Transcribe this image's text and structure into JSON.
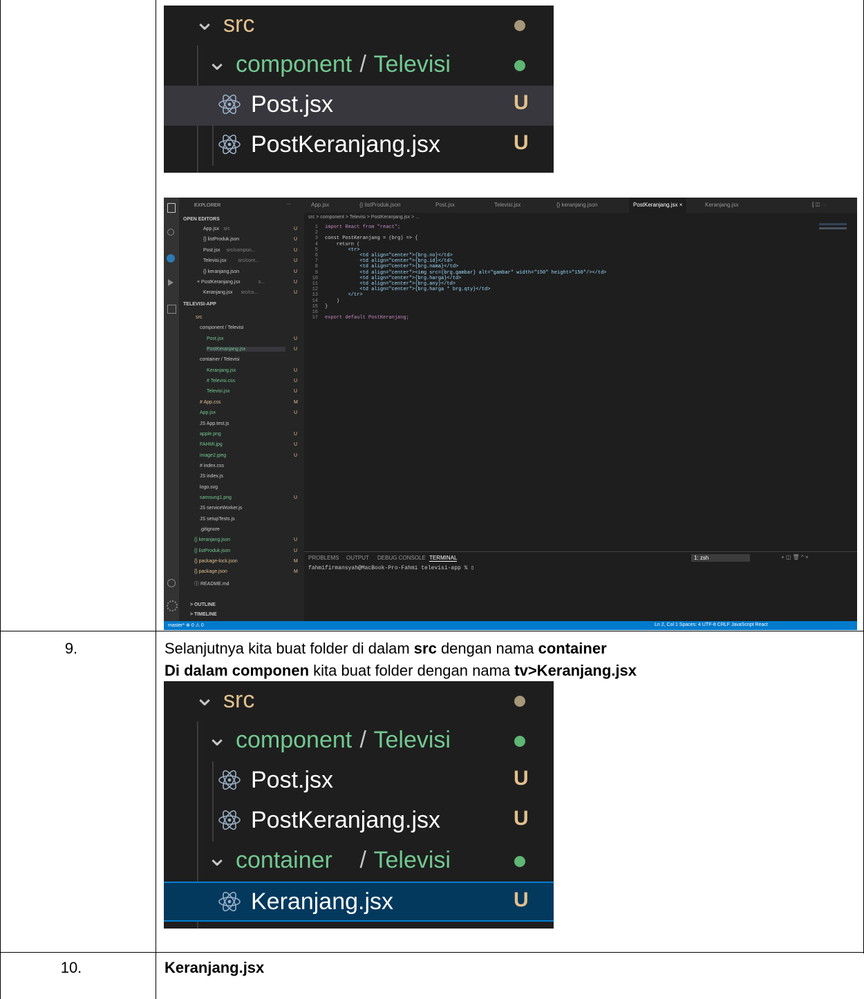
{
  "row8": {
    "crop1": {
      "items": [
        {
          "label": "src",
          "kind": "folder"
        },
        {
          "label": "component",
          "sep": "/",
          "label2": "Televisi",
          "kind": "folder"
        },
        {
          "label": "Post.jsx",
          "badge": "U",
          "kind": "file"
        },
        {
          "label": "PostKeranjang.jsx",
          "badge": "U",
          "kind": "file"
        }
      ]
    },
    "vscode": {
      "sidebar_title": "EXPLORER",
      "sidebar_dots": "···",
      "open_editors_label": "OPEN EDITORS",
      "open_editors": [
        {
          "label": "App.jsx",
          "desc": "src",
          "badge": "U"
        },
        {
          "label": "{} listProduk.json",
          "badge": "U"
        },
        {
          "label": "Post.jsx",
          "desc": "src/compon...",
          "badge": "U"
        },
        {
          "label": "Televisi.jsx",
          "desc": "src/cont...",
          "badge": "U"
        },
        {
          "label": "{} keranjang.json",
          "badge": "U"
        },
        {
          "label": "× PostKeranjang.jsx",
          "desc": "s...",
          "badge": "U"
        },
        {
          "label": "Keranjang.jsx",
          "desc": "src/co...",
          "badge": "U"
        }
      ],
      "project_label": "TELEVISI-APP",
      "tree": [
        {
          "label": "src",
          "badge": ""
        },
        {
          "label": "component / Televisi",
          "badge": ""
        },
        {
          "label": "Post.jsx",
          "badge": "U"
        },
        {
          "label": "PostKeranjang.jsx",
          "badge": "U"
        },
        {
          "label": "container / Televisi",
          "badge": ""
        },
        {
          "label": "Keranjang.jsx",
          "badge": "U"
        },
        {
          "label": "# Televisi.css",
          "badge": "U"
        },
        {
          "label": "Televisi.jsx",
          "badge": "U"
        },
        {
          "label": "# App.css",
          "badge": "M"
        },
        {
          "label": "App.jsx",
          "badge": "U"
        },
        {
          "label": "JS App.test.js",
          "badge": ""
        },
        {
          "label": "apple.png",
          "badge": "U"
        },
        {
          "label": "FAHMI.jpg",
          "badge": "U"
        },
        {
          "label": "image2.jpeg",
          "badge": "U"
        },
        {
          "label": "# index.css",
          "badge": ""
        },
        {
          "label": "JS index.js",
          "badge": ""
        },
        {
          "label": "logo.svg",
          "badge": ""
        },
        {
          "label": "samsung1.png",
          "badge": "U"
        },
        {
          "label": "JS serviceWorker.js",
          "badge": ""
        },
        {
          "label": "JS setupTests.js",
          "badge": ""
        },
        {
          "label": ".gitignore",
          "badge": ""
        },
        {
          "label": "{} keranjang.json",
          "badge": "U"
        },
        {
          "label": "{} listProduk.json",
          "badge": "U"
        },
        {
          "label": "{} package-lock.json",
          "badge": "M"
        },
        {
          "label": "{} package.json",
          "badge": "M"
        },
        {
          "label": "ⓘ README.md",
          "badge": ""
        }
      ],
      "outline_label": "> OUTLINE",
      "timeline_label": "> TIMELINE",
      "tabs": [
        "App.jsx",
        "{} listProduk.json",
        "Post.jsx",
        "Televisi.jsx",
        "{} keranjang.json",
        "PostKeranjang.jsx ×",
        "Keranjang.jsx"
      ],
      "breadcrumb": "src > component > Televisi > PostKeranjang.jsx > ...",
      "code_lines": [
        "import React from \"react\";",
        "",
        "const PostKeranjang = (brg) => {",
        "    return (",
        "        <tr>",
        "            <td align=\"center\">{brg.no}</td>",
        "            <td align=\"center\">{brg.id}</td>",
        "            <td align=\"center\">{brg.nama}</td>",
        "            <td align=\"center\"><img src={brg.gambar} alt=\"gambar\" width=\"150\" height=\"150\"/></td>",
        "            <td align=\"center\">{brg.harga}</td>",
        "            <td align=\"center\">{brg.any}</td>",
        "            <td align=\"center\">{brg.harga * brg.qty}</td>",
        "        </tr>",
        "    )",
        "}",
        "",
        "export default PostKeranjang;"
      ],
      "panel_tabs": [
        "PROBLEMS",
        "OUTPUT",
        "DEBUG CONSOLE",
        "TERMINAL"
      ],
      "terminal_select": "1: zsh",
      "terminal_line": "fahmifirmansyah@MacBook-Pro-Fahmi televisi-app % ▯",
      "status_left": "master*   ⊗ 0 ⚠ 0",
      "status_right": "Ln 2, Col 1   Spaces: 4   UTF-8   CRLF   JavaScript React"
    }
  },
  "row9": {
    "number": "9.",
    "line1_parts": [
      {
        "text": "Selanjutnya kita buat folder di dalam ",
        "bold": false
      },
      {
        "text": "src",
        "bold": true
      },
      {
        "text": " dengan nama ",
        "bold": false
      },
      {
        "text": "container",
        "bold": true
      }
    ],
    "line2_parts": [
      {
        "text": "Di dalam componen",
        "bold": true
      },
      {
        "text": " kita buat folder dengan nama ",
        "bold": false
      },
      {
        "text": "tv>Keranjang.jsx",
        "bold": true
      }
    ],
    "crop2": {
      "items": [
        {
          "label": "src",
          "kind": "folder"
        },
        {
          "label": "component",
          "sep": "/",
          "label2": "Televisi",
          "kind": "folder"
        },
        {
          "label": "Post.jsx",
          "badge": "U",
          "kind": "file"
        },
        {
          "label": "PostKeranjang.jsx",
          "badge": "U",
          "kind": "file"
        },
        {
          "label": "container",
          "sep": "/",
          "label2": "Televisi",
          "kind": "folder"
        },
        {
          "label": "Keranjang.jsx",
          "badge": "U",
          "kind": "file",
          "selected": true
        }
      ]
    }
  },
  "row10": {
    "number": "10.",
    "title": "Keranjang.jsx"
  },
  "colors": {
    "src_folder": "#e2c08d",
    "folder_green": "#73c991",
    "file_white": "#ffffff",
    "badge_u": "#e2c08d",
    "selected_bg": "#04395e",
    "selected_border": "#007fd4"
  }
}
